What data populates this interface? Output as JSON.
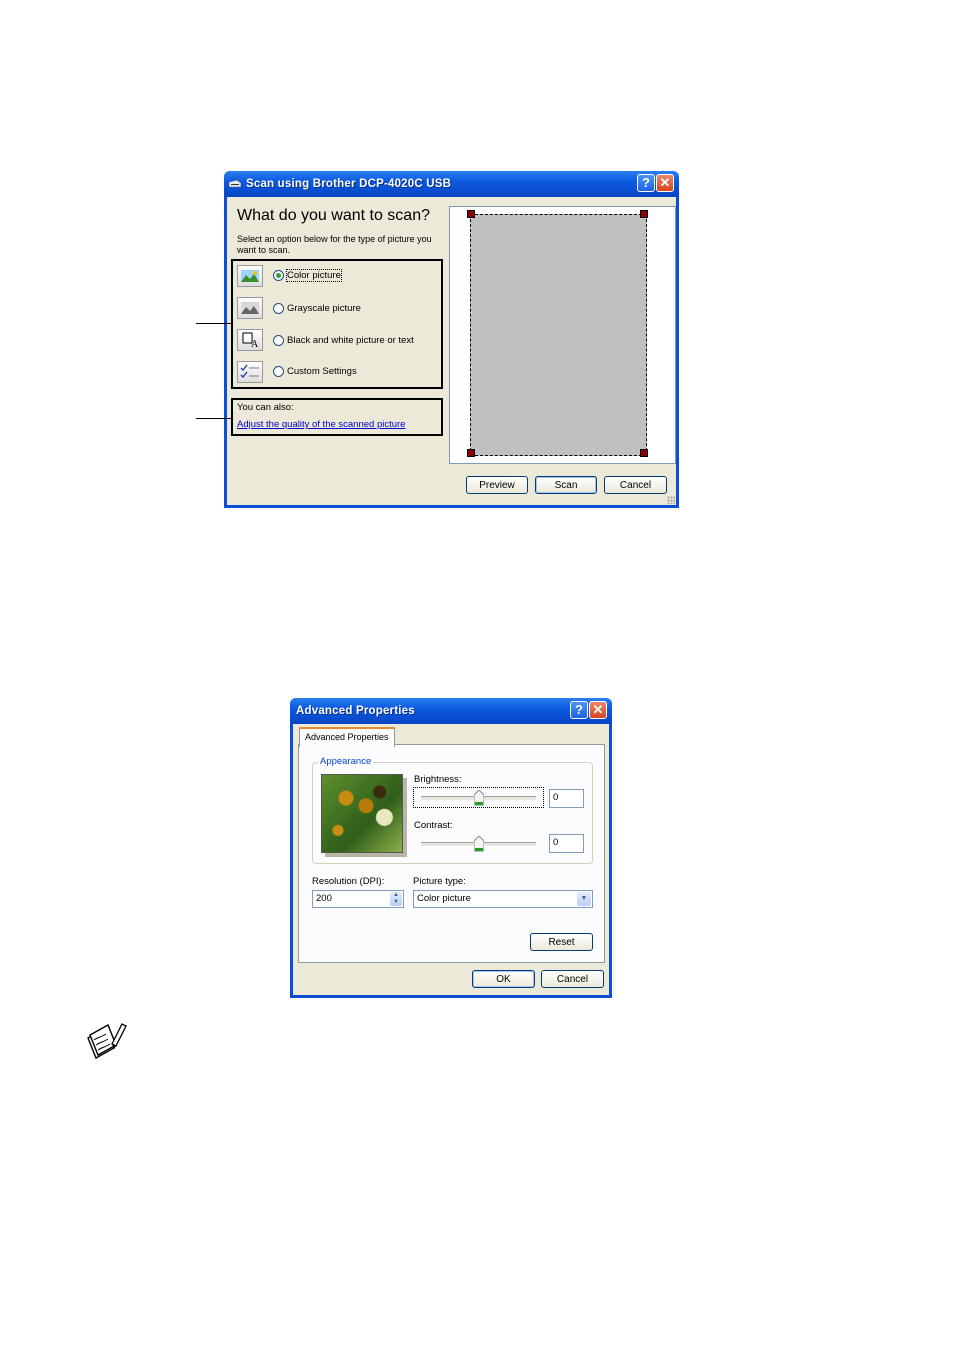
{
  "scan_dialog": {
    "title": "Scan using Brother DCP-4020C USB",
    "heading": "What do you want to scan?",
    "instructions": "Select an option below for the type of picture you want to scan.",
    "options": [
      {
        "label": "Color picture",
        "selected": true,
        "icon": "color-picture-icon"
      },
      {
        "label": "Grayscale picture",
        "selected": false,
        "icon": "grayscale-picture-icon"
      },
      {
        "label": "Black and white picture or text",
        "selected": false,
        "icon": "black-white-text-icon"
      },
      {
        "label": "Custom Settings",
        "selected": false,
        "icon": "custom-settings-icon"
      }
    ],
    "also_label": "You can also:",
    "adjust_link": "Adjust the quality of the scanned picture",
    "buttons": {
      "preview": "Preview",
      "scan": "Scan",
      "cancel": "Cancel"
    },
    "help_glyph": "?",
    "close_glyph": "✕"
  },
  "advanced_dialog": {
    "title": "Advanced Properties",
    "tab_label": "Advanced Properties",
    "group_label": "Appearance",
    "brightness_label": "Brightness:",
    "brightness_value": "0",
    "brightness_level": 0.5,
    "contrast_label": "Contrast:",
    "contrast_value": "0",
    "contrast_level": 0.5,
    "resolution_label": "Resolution (DPI):",
    "resolution_value": "200",
    "picture_type_label": "Picture type:",
    "picture_type_value": "Color picture",
    "buttons": {
      "reset": "Reset",
      "ok": "OK",
      "cancel": "Cancel"
    },
    "help_glyph": "?",
    "close_glyph": "✕"
  },
  "note_icon": "note-pencil-icon"
}
